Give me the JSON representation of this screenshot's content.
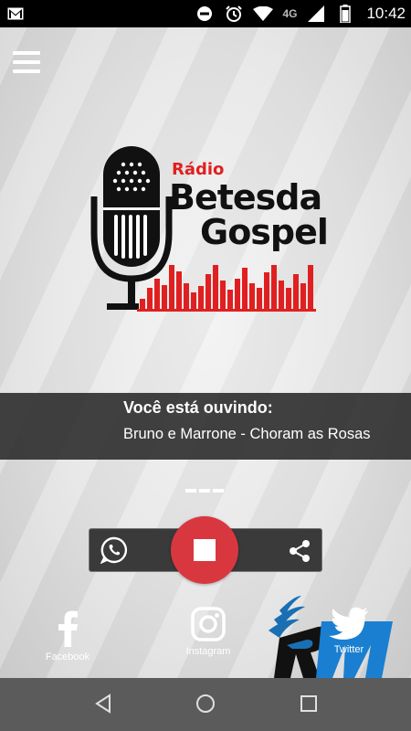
{
  "status_bar": {
    "network": "4G",
    "time": "10:42",
    "icons": [
      "gmail-icon",
      "dnd-icon",
      "alarm-icon",
      "wifi-icon",
      "signal-icon",
      "battery-icon"
    ]
  },
  "logo": {
    "small": "Rádio",
    "line1": "Betesda",
    "line2": "Gospel"
  },
  "now_playing": {
    "label": "Você está ouvindo:",
    "track": "Bruno e Marrone - Choram as Rosas"
  },
  "social": {
    "facebook": "Facebook",
    "instagram": "Instagram",
    "twitter": "Twitter"
  },
  "colors": {
    "accent_red": "#d9373f",
    "logo_red": "#e02020",
    "status_bar": "#000000",
    "nav_bar": "#5b5b5b"
  }
}
